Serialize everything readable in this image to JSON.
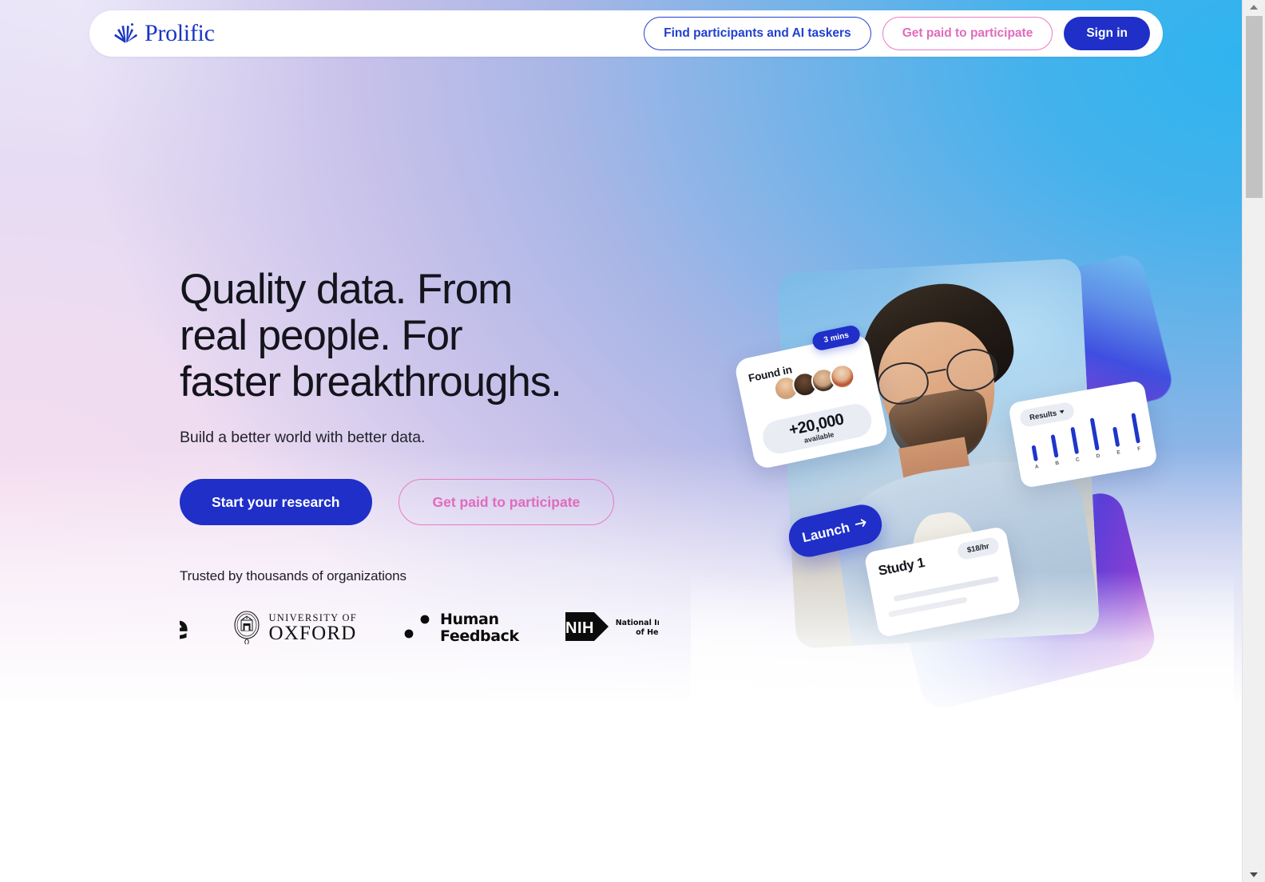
{
  "brand": {
    "name": "Prolific",
    "logo_icon": "sunburst-icon",
    "primary_blue": "#1f2fc8",
    "accent_pink": "#e06bbd",
    "text_dark": "#14141c"
  },
  "nav": {
    "find_participants_label": "Find participants and AI taskers",
    "get_paid_label": "Get paid to participate",
    "sign_in_label": "Sign in"
  },
  "hero": {
    "headline_line1": "Quality data. From",
    "headline_line2": "real people. For",
    "headline_line3": "faster breakthroughs.",
    "subhead": "Build a better world with better data.",
    "cta_primary": "Start your research",
    "cta_secondary": "Get paid to participate"
  },
  "trusted": {
    "label": "Trusted by thousands of organizations",
    "logos": [
      {
        "name": "google-logo",
        "text": "gle"
      },
      {
        "name": "oxford-logo",
        "line1": "UNIVERSITY OF",
        "line2": "OXFORD"
      },
      {
        "name": "human-feedback-logo",
        "line1": "Human",
        "line2": "Feedback"
      },
      {
        "name": "nih-logo",
        "mark": "NIH",
        "line1": "National Institutes",
        "line2": "of Health"
      }
    ]
  },
  "hero_art": {
    "found_card": {
      "title": "Found in",
      "badge": "3 mins",
      "count": "+20,000",
      "count_sub": "available",
      "avatar_count": 4
    },
    "results_card": {
      "label": "Results",
      "dropdown_icon": "chevron-down-icon"
    },
    "launch_button": {
      "label": "Launch",
      "icon": "arrow-right-icon"
    },
    "study_card": {
      "title": "Study 1",
      "rate": "$18/hr"
    }
  },
  "chart_data": {
    "type": "bar",
    "title": "Results",
    "categories": [
      "A",
      "B",
      "C",
      "D",
      "E",
      "F"
    ],
    "values": [
      30,
      44,
      52,
      62,
      38,
      58
    ],
    "xlabel": "",
    "ylabel": "",
    "ylim": [
      0,
      70
    ],
    "series_color": "#1f35cc",
    "grid": false,
    "legend": "none"
  },
  "scrollbar": {
    "up_arrow": "scroll-up-arrow",
    "down_arrow": "scroll-down-arrow"
  }
}
